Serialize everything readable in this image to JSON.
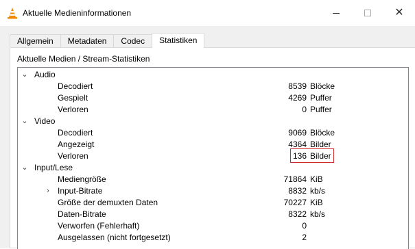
{
  "window": {
    "title": "Aktuelle Medieninformationen",
    "icon": "vlc-cone-icon"
  },
  "tabs": [
    {
      "label": "Allgemein",
      "active": false
    },
    {
      "label": "Metadaten",
      "active": false
    },
    {
      "label": "Codec",
      "active": false
    },
    {
      "label": "Statistiken",
      "active": true
    }
  ],
  "panel": {
    "label": "Aktuelle Medien / Stream-Statistiken"
  },
  "tree": {
    "audio": {
      "label": "Audio",
      "items": [
        {
          "label": "Decodiert",
          "value": "8539",
          "unit": "Blöcke"
        },
        {
          "label": "Gespielt",
          "value": "4269",
          "unit": "Puffer"
        },
        {
          "label": "Verloren",
          "value": "0",
          "unit": "Puffer"
        }
      ]
    },
    "video": {
      "label": "Video",
      "items": [
        {
          "label": "Decodiert",
          "value": "9069",
          "unit": "Blöcke"
        },
        {
          "label": "Angezeigt",
          "value": "4364",
          "unit": "Bilder"
        },
        {
          "label": "Verloren",
          "value": "136",
          "unit": "Bilder",
          "highlighted": true
        }
      ]
    },
    "input": {
      "label": "Input/Lese",
      "items": [
        {
          "label": "Mediengröße",
          "value": "71864",
          "unit": "KiB"
        },
        {
          "label": "Input-Bitrate",
          "value": "8832",
          "unit": "kb/s",
          "collapsed": true
        },
        {
          "label": "Größe der demuxten Daten",
          "value": "70227",
          "unit": "KiB"
        },
        {
          "label": "Daten-Bitrate",
          "value": "8322",
          "unit": "kb/s"
        },
        {
          "label": "Verworfen (Fehlerhaft)",
          "value": "0",
          "unit": ""
        },
        {
          "label": "Ausgelassen (nicht fortgesetzt)",
          "value": "2",
          "unit": ""
        }
      ]
    }
  },
  "colors": {
    "highlight_border": "#d22b2b",
    "dialog_bg": "#f0f0f0"
  }
}
